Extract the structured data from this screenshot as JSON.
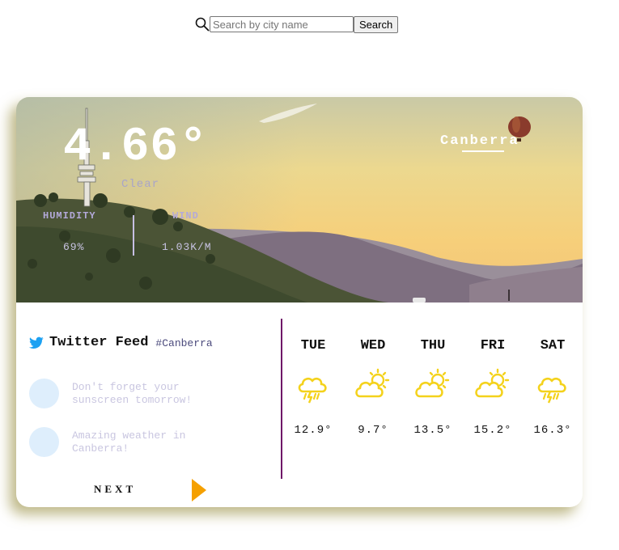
{
  "search": {
    "placeholder": "Search by city name",
    "value": "",
    "button_label": "Search"
  },
  "current": {
    "temperature": "4.66°",
    "condition": "Clear",
    "city": "Canberra",
    "humidity_label": "HUMIDITY",
    "humidity_value": "69%",
    "wind_label": "WIND",
    "wind_value": "1.03K/M"
  },
  "twitter": {
    "title": "Twitter Feed",
    "hashtag": "#Canberra",
    "tweets": [
      {
        "text": "Don't forget your sunscreen tomorrow!"
      },
      {
        "text": "Amazing weather in Canberra!"
      }
    ],
    "next_label": "NEXT"
  },
  "forecast": [
    {
      "day": "TUE",
      "icon": "rain-cloud-icon",
      "temp": "12.9°"
    },
    {
      "day": "WED",
      "icon": "partly-cloudy-icon",
      "temp": "9.7°"
    },
    {
      "day": "THU",
      "icon": "partly-cloudy-icon",
      "temp": "13.5°"
    },
    {
      "day": "FRI",
      "icon": "partly-cloudy-icon",
      "temp": "15.2°"
    },
    {
      "day": "SAT",
      "icon": "rain-cloud-icon",
      "temp": "16.3°"
    }
  ],
  "colors": {
    "accent_divider": "#6f1768",
    "next_arrow": "#f5a000",
    "weather_icon": "#f4d21c",
    "twitter_blue": "#1da1f2"
  }
}
